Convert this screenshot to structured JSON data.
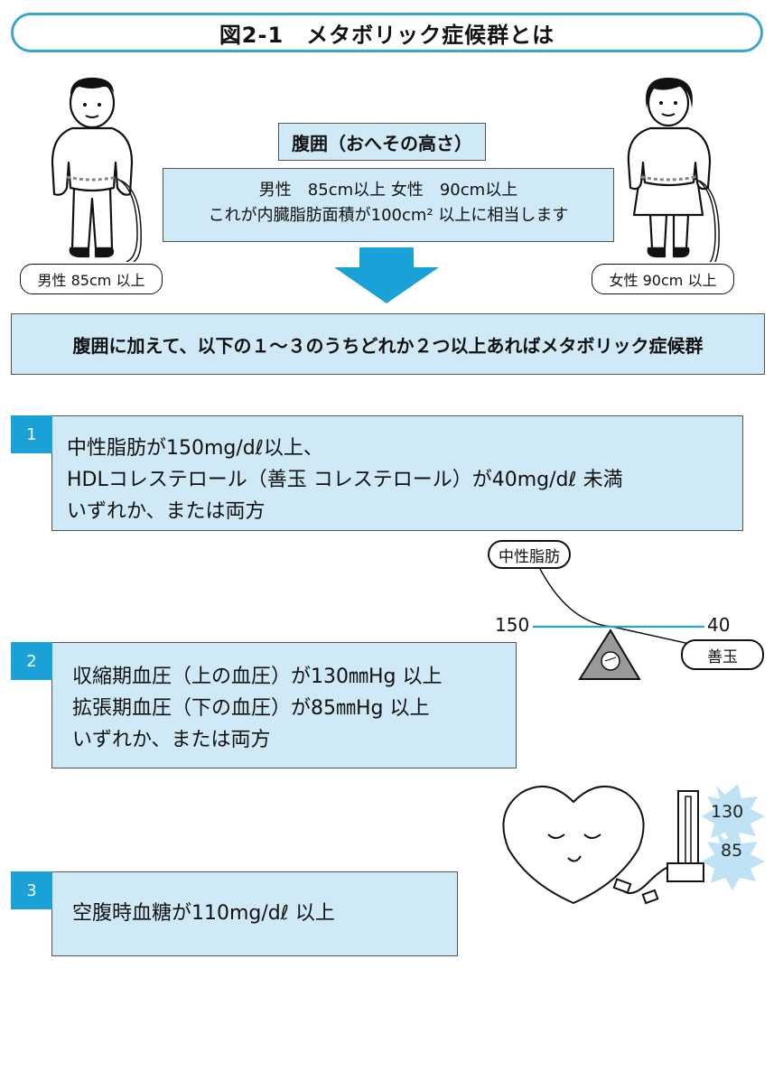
{
  "title": "図2-1　メタボリック症候群とは",
  "waist": {
    "heading": "腹囲（おへその高さ）",
    "line1": "男性　85cm以上 女性　90cm以上",
    "line2": "これが内臓脂肪面積が100cm² 以上に相当します"
  },
  "male_label": "男性 85cm 以上",
  "female_label": "女性 90cm 以上",
  "banner": "腹囲に加えて、以下の１～３のうちどれか２つ以上あればメタボリック症候群",
  "criteria": [
    {
      "number": "1",
      "lines": [
        "中性脂肪が150mg/dℓ以上、",
        "HDLコレステロール（善玉 コレステロール）が40mg/dℓ 未満",
        "いずれか、または両方"
      ]
    },
    {
      "number": "2",
      "lines": [
        "収縮期血圧（上の血圧）が130㎜Hg 以上",
        "拡張期血圧（下の血圧）が85㎜Hg 以上",
        "いずれか、または両方"
      ]
    },
    {
      "number": "3",
      "lines": [
        "空腹時血糖が110mg/dℓ 以上"
      ]
    }
  ],
  "scale": {
    "left_label": "中性脂肪",
    "right_label": "善玉",
    "left_value": "150",
    "right_value": "40"
  },
  "bp": {
    "upper": "130",
    "lower": "85"
  },
  "colors": {
    "accent": "#1aa1d8",
    "box_fill": "#cfe9f7",
    "border": "#3aa6cf"
  }
}
